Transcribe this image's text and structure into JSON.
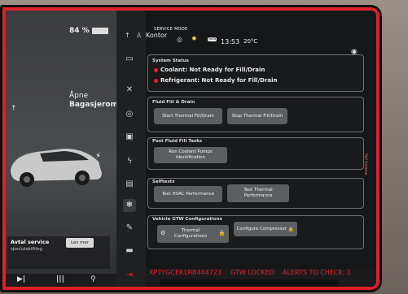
{
  "left_panel": {
    "battery_percent": "84 %",
    "trunk_line1": "Åpne",
    "trunk_line2": "Bagasjerom",
    "service_title": "Avtal service",
    "service_subtitle": "sjon/utskifting",
    "service_button": "Les mer",
    "bottom_icons": [
      "play-icon",
      "equalizer-icon",
      "search-icon"
    ]
  },
  "header": {
    "service_mode": "SERVICE MODE",
    "location": "Kontor",
    "sos_label": "SOS",
    "time": "13:53",
    "temperature": "20°C"
  },
  "sidebar": {
    "items": [
      "car-icon",
      "tools-icon",
      "steering-wheel-icon",
      "chip-icon",
      "bolt-icon",
      "battery-icon",
      "hvac-fan-icon",
      "pen-icon",
      "seat-icon",
      "exit-icon"
    ],
    "active_index": 6
  },
  "system_status": {
    "title": "System Status",
    "coolant": "Coolant: Not Ready for Fill/Drain",
    "refrigerant": "Refrigerant: Not Ready for Fill/Drain",
    "status_color": "#e0202b"
  },
  "fluid_fill": {
    "title": "Fluid Fill & Drain",
    "start_button": "Start Thermal Fill/Drain",
    "stop_button": "Stop Thermal Fill/Drain"
  },
  "post_fill": {
    "title": "Post Fluid Fill Tasks",
    "button_line1": "Run Coolant Pumps",
    "button_line2": "Identification"
  },
  "selftests": {
    "title": "Selftests",
    "hvac_button": "Test HVAC Performance",
    "thermal_line1": "Test Thermal",
    "thermal_line2": "Performance"
  },
  "gtw": {
    "title": "Vehicle GTW Configurations",
    "thermal_line1": "Thermal",
    "thermal_line2": "Configurations",
    "compressor_button": "Configure Compressor"
  },
  "footer": {
    "vin": "XP7YGCEK1RB444723",
    "gtw_state": "GTW LOCKED",
    "alerts": "ALERTS TO CHECK: 1"
  },
  "side_label": "Poll Exterior",
  "colors": {
    "frame_red": "#e0202b",
    "button_gray": "#5d5e61",
    "panel_border": "#6e6e70"
  }
}
